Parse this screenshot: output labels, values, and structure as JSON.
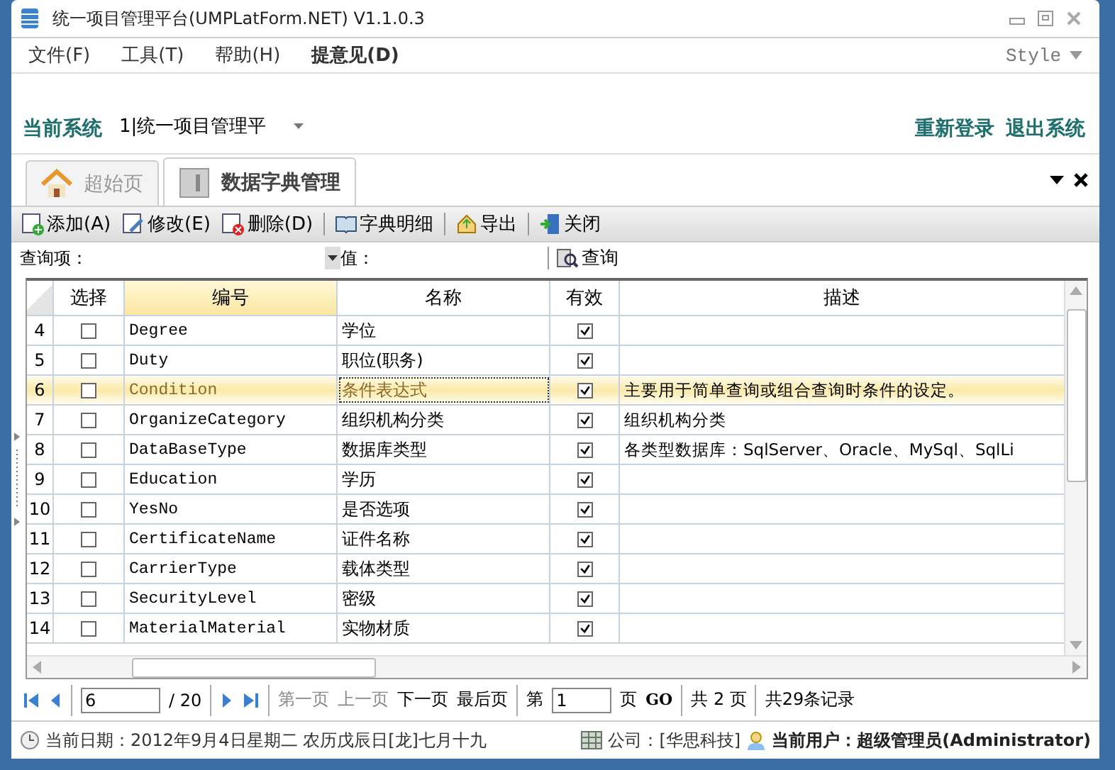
{
  "window": {
    "title": "统一项目管理平台(UMPLatForm.NET) V1.1.0.3"
  },
  "menu": [
    {
      "label": "文件(F)",
      "bold": false
    },
    {
      "label": "工具(T)",
      "bold": false
    },
    {
      "label": "帮助(H)",
      "bold": false
    },
    {
      "label": "提意见(D)",
      "bold": true
    }
  ],
  "style_menu": "Style",
  "header": {
    "system_label": "当前系统",
    "system_value": "1|统一项目管理平",
    "links": [
      "重新登录",
      "退出系统"
    ]
  },
  "tabs": [
    {
      "label": "超始页",
      "kind": "home",
      "selected": false
    },
    {
      "label": "数据字典管理",
      "kind": "dictionary",
      "selected": true
    }
  ],
  "toolbar": [
    {
      "label": "添加(A)",
      "kind": "add"
    },
    {
      "label": "修改(E)",
      "kind": "edit"
    },
    {
      "label": "删除(D)",
      "kind": "delete"
    },
    {
      "label": "字典明细",
      "kind": "book"
    },
    {
      "label": "导出",
      "kind": "export"
    },
    {
      "label": "关闭",
      "kind": "exit"
    }
  ],
  "query": {
    "field_label": "查询项：",
    "value_label": "值：",
    "button": "查询"
  },
  "table": {
    "columns": [
      "选择",
      "编号",
      "名称",
      "有效",
      "描述"
    ],
    "rows": [
      {
        "number": "4",
        "checked": false,
        "code": "Degree",
        "name": "学位",
        "valid": true,
        "description": "",
        "selected": false
      },
      {
        "number": "5",
        "checked": false,
        "code": "Duty",
        "name": "职位(职务)",
        "valid": true,
        "description": "",
        "selected": false
      },
      {
        "number": "6",
        "checked": false,
        "code": "Condition",
        "name": "条件表达式",
        "valid": true,
        "description": "主要用于简单查询或组合查询时条件的设定。",
        "selected": true
      },
      {
        "number": "7",
        "checked": false,
        "code": "OrganizeCategory",
        "name": "组织机构分类",
        "valid": true,
        "description": "组织机构分类",
        "selected": false
      },
      {
        "number": "8",
        "checked": false,
        "code": "DataBaseType",
        "name": "数据库类型",
        "valid": true,
        "description": "各类型数据库：SqlServer、Oracle、MySql、SqlLi",
        "selected": false
      },
      {
        "number": "9",
        "checked": false,
        "code": "Education",
        "name": "学历",
        "valid": true,
        "description": "",
        "selected": false
      },
      {
        "number": "10",
        "checked": false,
        "code": "YesNo",
        "name": "是否选项",
        "valid": true,
        "description": "",
        "selected": false
      },
      {
        "number": "11",
        "checked": false,
        "code": "CertificateName",
        "name": "证件名称",
        "valid": true,
        "description": "",
        "selected": false
      },
      {
        "number": "12",
        "checked": false,
        "code": "CarrierType",
        "name": "载体类型",
        "valid": true,
        "description": "",
        "selected": false
      },
      {
        "number": "13",
        "checked": false,
        "code": "SecurityLevel",
        "name": "密级",
        "valid": true,
        "description": "",
        "selected": false
      },
      {
        "number": "14",
        "checked": false,
        "code": "MaterialMaterial",
        "name": "实物材质",
        "valid": true,
        "description": "",
        "selected": false
      }
    ]
  },
  "pager": {
    "page": "6",
    "total": "/ 20",
    "links": [
      {
        "label": "第一页",
        "disabled": true
      },
      {
        "label": "上一页",
        "disabled": true
      },
      {
        "label": "下一页",
        "disabled": false
      },
      {
        "label": "最后页",
        "disabled": false
      }
    ],
    "goto_prefix": "第",
    "goto_value": "1",
    "goto_suffix": "页",
    "go": "GO",
    "page_count": "共 2 页",
    "record_count": "共29条记录"
  },
  "status_bar": {
    "date": "当前日期：2012年9月4日星期二 农历戊辰日[龙]七月十九",
    "company": "公司：[华思科技]",
    "user": "当前用户：超级管理员(Administrator)"
  }
}
